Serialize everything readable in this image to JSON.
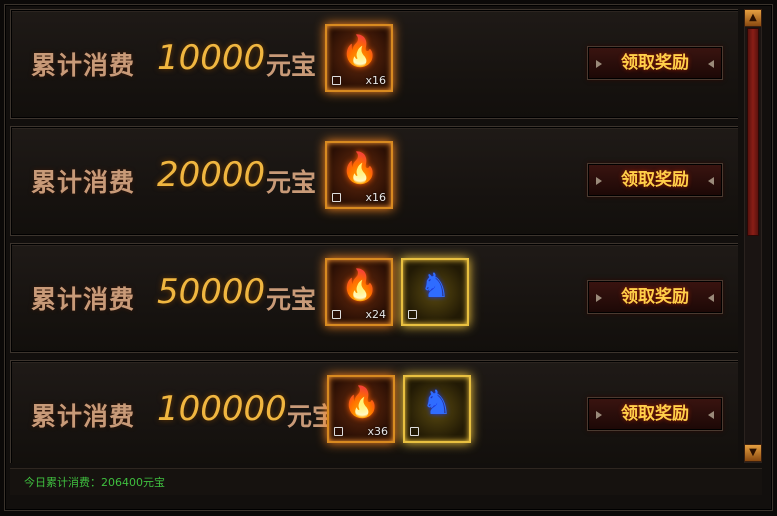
{
  "rows": [
    {
      "label": "累计消费",
      "amount": "10000",
      "unit": "元宝",
      "items": [
        {
          "icon": "fire-crystal-icon",
          "glyph": "🔥",
          "count": "x16",
          "style": "orange"
        }
      ],
      "button": "领取奖励"
    },
    {
      "label": "累计消费",
      "amount": "20000",
      "unit": "元宝",
      "items": [
        {
          "icon": "fire-crystal-icon",
          "glyph": "🔥",
          "count": "x16",
          "style": "orange"
        }
      ],
      "button": "领取奖励"
    },
    {
      "label": "累计消费",
      "amount": "50000",
      "unit": "元宝",
      "items": [
        {
          "icon": "fire-crystal-icon",
          "glyph": "🔥",
          "count": "x24",
          "style": "orange"
        },
        {
          "icon": "blue-spirit-icon",
          "glyph": "♞",
          "count": "",
          "style": "gold"
        }
      ],
      "button": "领取奖励"
    },
    {
      "label": "累计消费",
      "amount": "100000",
      "unit": "元宝",
      "items": [
        {
          "icon": "fire-crystal-icon",
          "glyph": "🔥",
          "count": "x36",
          "style": "orange"
        },
        {
          "icon": "blue-spirit-icon",
          "glyph": "♞",
          "count": "",
          "style": "gold"
        }
      ],
      "button": "领取奖励"
    }
  ],
  "footer": {
    "text": "今日累计消费：206400元宝"
  },
  "scrollbar": {
    "up_icon": "arrow-up-icon",
    "down_icon": "arrow-down-icon",
    "up_glyph": "▲",
    "down_glyph": "▼"
  }
}
